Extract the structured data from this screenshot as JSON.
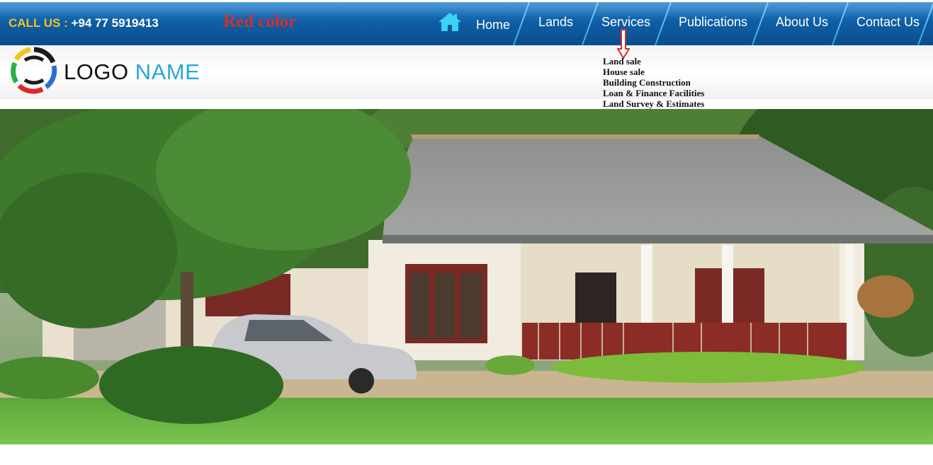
{
  "topbar": {
    "call_label": "CALL US :",
    "phone": "+94 77 5919413",
    "note": "Red color"
  },
  "nav": {
    "items": [
      {
        "label": "Home"
      },
      {
        "label": "Lands"
      },
      {
        "label": "Services"
      },
      {
        "label": "Publications"
      },
      {
        "label": "About Us"
      },
      {
        "label": "Contact Us"
      }
    ]
  },
  "logo": {
    "word1": "LOGO",
    "word2": "NAME"
  },
  "services_menu": {
    "items": [
      "Land sale",
      "House sale",
      "Building Construction",
      "Loan & Finance Facilities",
      "Land Survey & Estimates"
    ]
  },
  "colors": {
    "nav_blue": "#0f5fa6",
    "call_yellow": "#f7c21f",
    "note_red": "#d0312d",
    "logo_blue": "#2aa6dc",
    "home_icon": "#3ad2f5"
  },
  "icons": {
    "home": "home-icon",
    "arrow": "down-arrow-icon",
    "logo": "logo-ring-icon"
  }
}
